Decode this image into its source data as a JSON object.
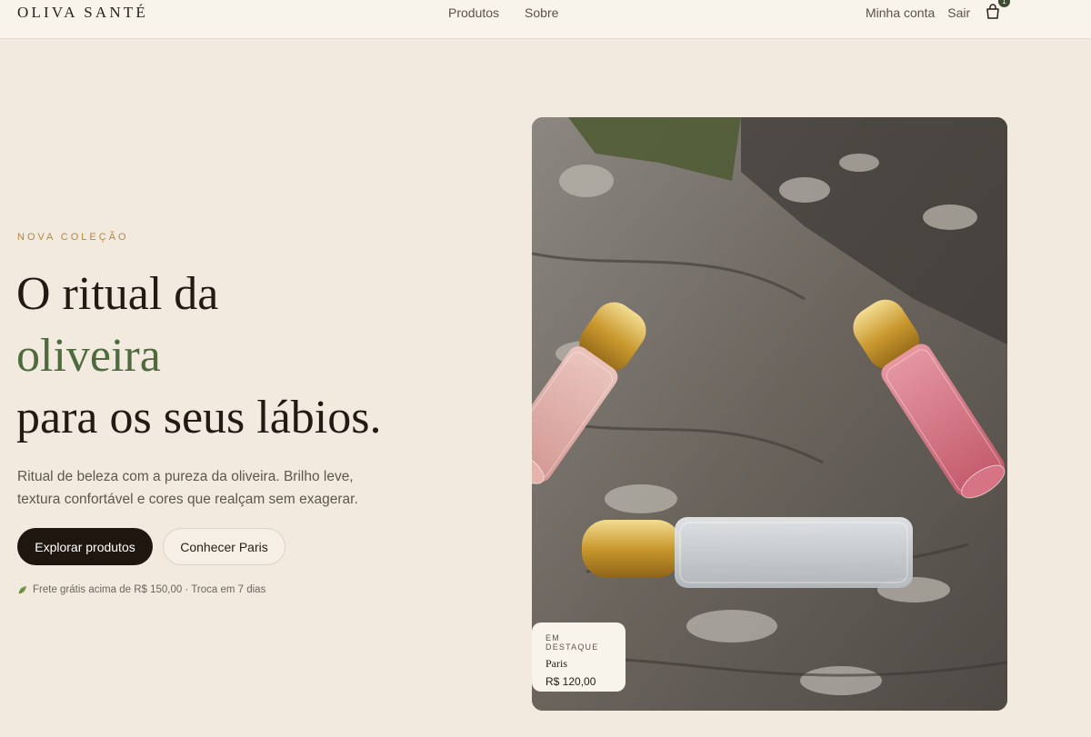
{
  "header": {
    "brand": "OLIVA SANTÉ",
    "nav": [
      "Produtos",
      "Sobre"
    ],
    "account": "Minha conta",
    "logout": "Sair",
    "cart_count": "1"
  },
  "hero": {
    "eyebrow": "NOVA COLEÇÃO",
    "headline_1": "O ritual da",
    "headline_accent": "oliveira",
    "headline_2": "para os seus lábios.",
    "lead": "Ritual de beleza com a pureza da oliveira. Brilho leve, textura confortável e cores que realçam sem exagerar.",
    "primary_cta": "Explorar produtos",
    "secondary_cta": "Conhecer Paris",
    "shipping_note": "Frete grátis acima de R$ 150,00 · Troca em 7 dias"
  },
  "featured": {
    "tag": "EM DESTAQUE",
    "name": "Paris",
    "price": "R$ 120,00"
  },
  "colors": {
    "background": "#f2eadf",
    "accent_green": "#4f6a3d",
    "eyebrow_gold": "#b38a3c",
    "button_dark": "#1f170f"
  },
  "icons": [
    "cart-icon",
    "leaf-icon"
  ]
}
